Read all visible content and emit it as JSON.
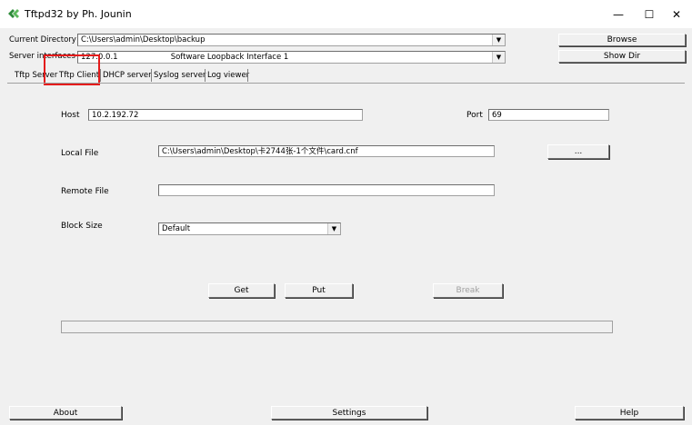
{
  "window": {
    "title": "Tftpd32 by Ph. Jounin",
    "minimize": "—",
    "maximize": "☐",
    "close": "✕"
  },
  "top": {
    "current_directory_label": "Current Directory",
    "current_directory_value": "C:\\Users\\admin\\Desktop\\backup",
    "browse_label": "Browse",
    "server_interfaces_label": "Server interfaces",
    "server_interfaces_ip": "127.0.0.1",
    "server_interfaces_name": "Software Loopback Interface 1",
    "show_dir_label": "Show Dir"
  },
  "tabs": [
    {
      "label": "Tftp Server"
    },
    {
      "label": "Tftp Client"
    },
    {
      "label": "DHCP server"
    },
    {
      "label": "Syslog server"
    },
    {
      "label": "Log viewer"
    }
  ],
  "client": {
    "host_label": "Host",
    "host_value": "10.2.192.72",
    "port_label": "Port",
    "port_value": "69",
    "local_file_label": "Local File",
    "local_file_value": "C:\\Users\\admin\\Desktop\\卡2744张-1个文件\\card.cnf",
    "browse_file_label": "...",
    "remote_file_label": "Remote File",
    "remote_file_value": "",
    "block_size_label": "Block Size",
    "block_size_value": "Default",
    "get_label": "Get",
    "put_label": "Put",
    "break_label": "Break"
  },
  "bottom": {
    "about_label": "About",
    "settings_label": "Settings",
    "help_label": "Help"
  },
  "colors": {
    "highlight": "#e41b1b",
    "window_bg": "#f0f0f0"
  }
}
